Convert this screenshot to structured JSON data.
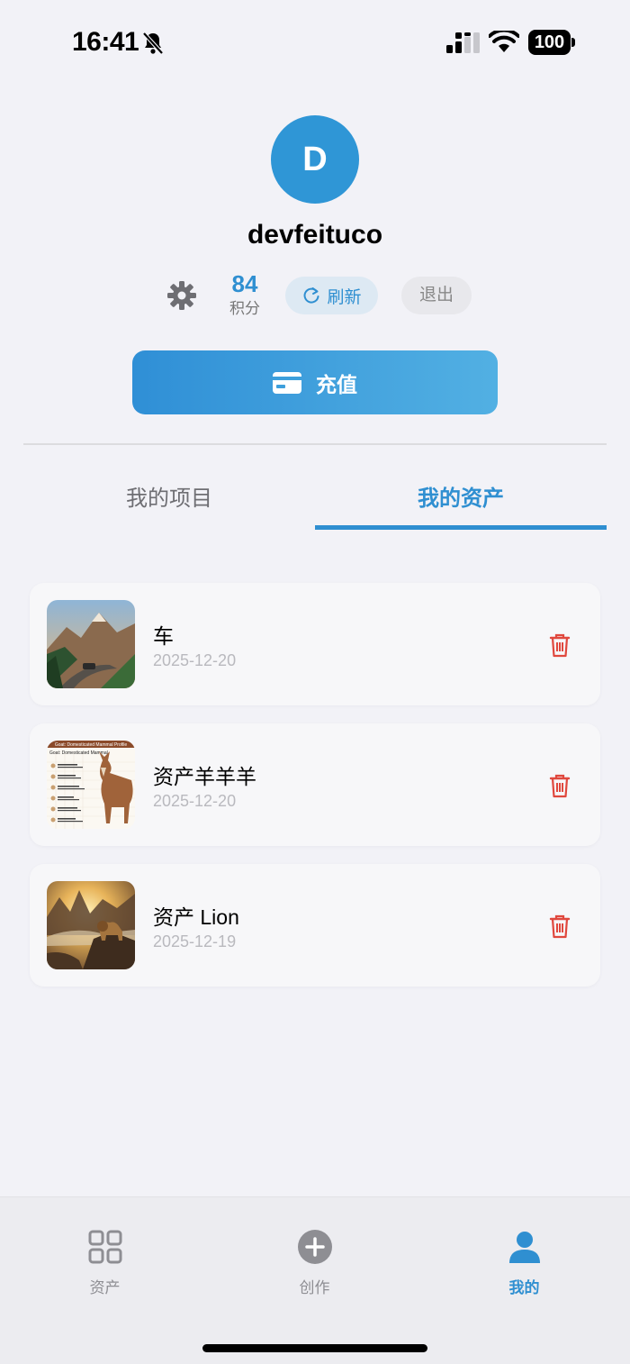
{
  "status_bar": {
    "time": "16:41",
    "battery": "100"
  },
  "profile": {
    "avatar_letter": "D",
    "username": "devfeituco",
    "points_value": "84",
    "points_label": "积分",
    "refresh_label": "刷新",
    "logout_label": "退出",
    "recharge_label": "充值"
  },
  "tabs": {
    "projects": "我的项目",
    "assets": "我的资产",
    "active": "assets"
  },
  "assets": [
    {
      "name": "车",
      "date": "2025-12-20",
      "thumb_icon": "mountain-road-car-image"
    },
    {
      "name": "资产羊羊羊",
      "date": "2025-12-20",
      "thumb_icon": "goat-infographic-image",
      "thumb_title": "Goat: Domesticated Mammal Profile",
      "thumb_heading": "Goat: Domesticated Mammal"
    },
    {
      "name": "资产 Lion",
      "date": "2025-12-19",
      "thumb_icon": "lion-mountain-sunrise-image"
    }
  ],
  "tabbar": {
    "assets_label": "资产",
    "create_label": "创作",
    "mine_label": "我的",
    "active": "mine"
  },
  "colors": {
    "accent": "#2f8fd1",
    "danger": "#e0483e",
    "background": "#f2f2f7"
  }
}
